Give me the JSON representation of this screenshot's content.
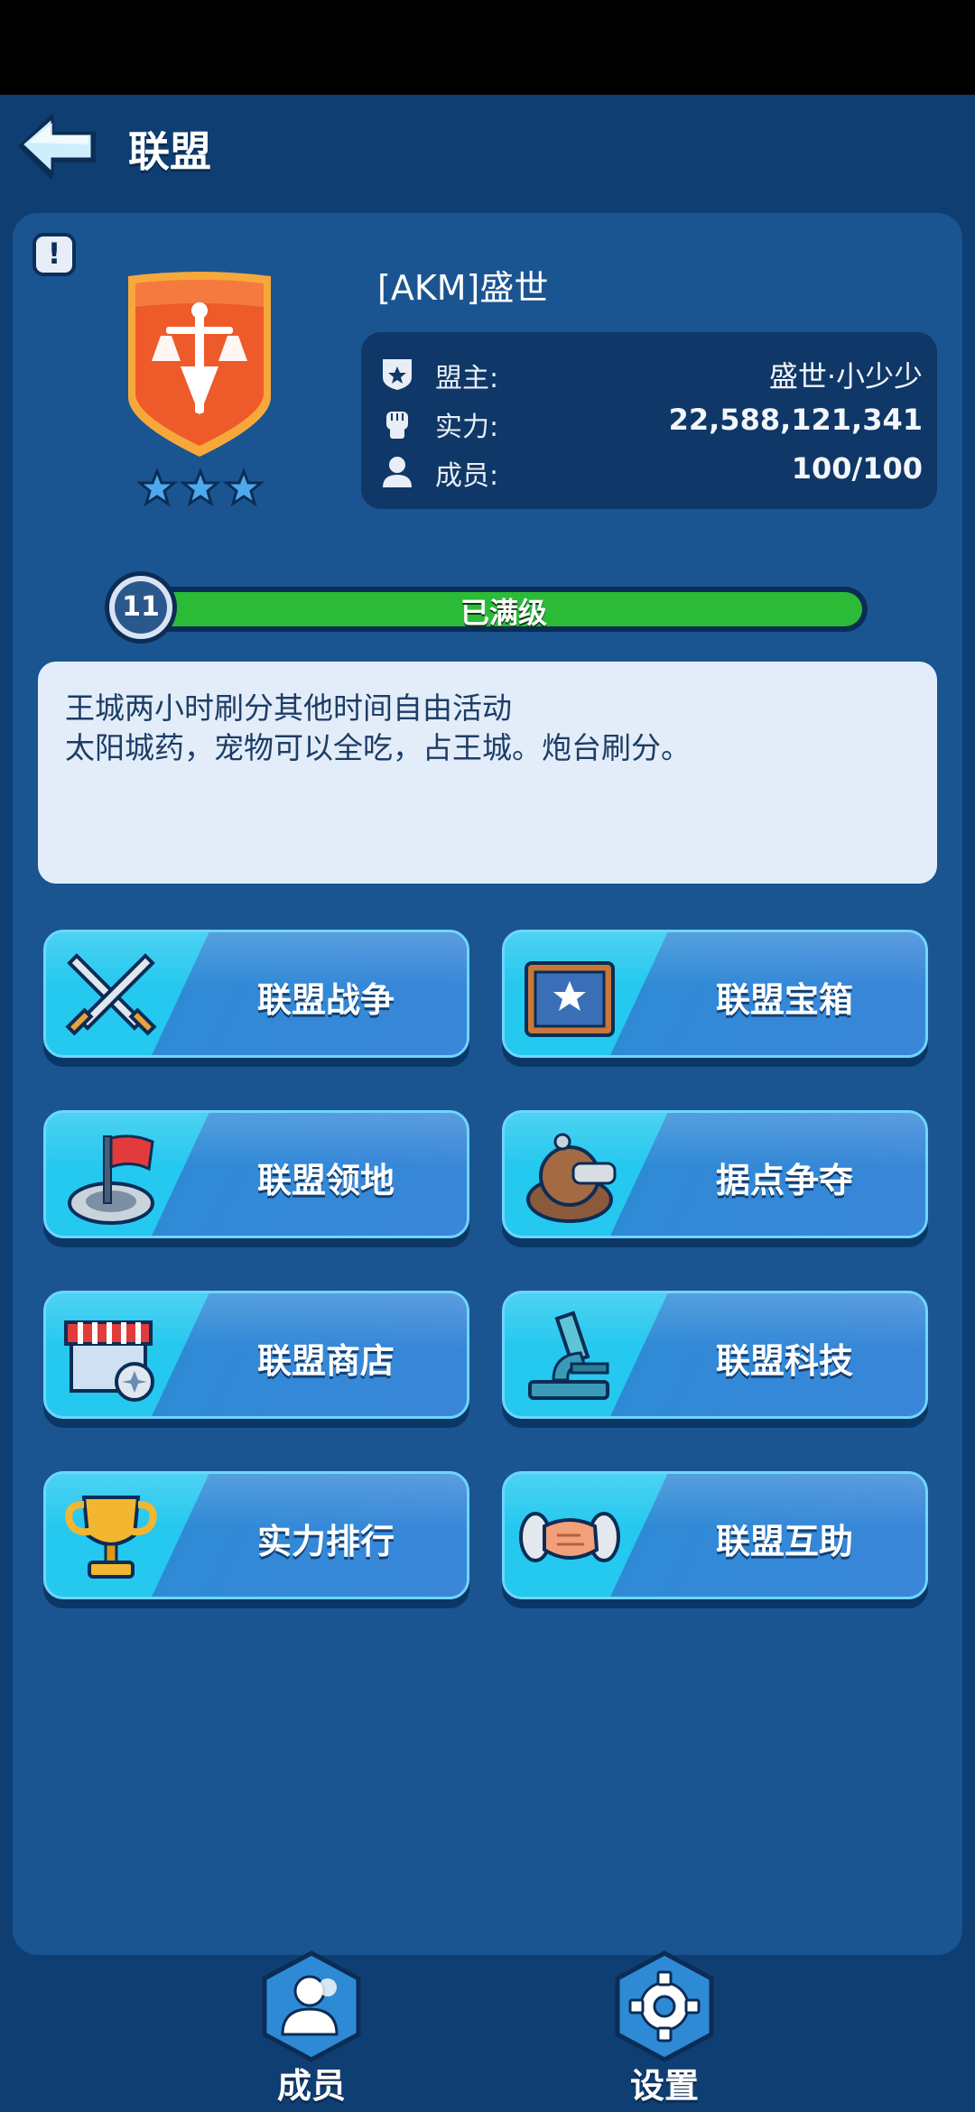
{
  "header": {
    "title": "联盟",
    "back_icon": "back-arrow-icon"
  },
  "guild": {
    "name": "[AKM]盛世",
    "stars": 3,
    "leader_label": "盟主:",
    "leader_value": "盛世·小少少",
    "power_label": "实力:",
    "power_value": "22,588,121,341",
    "members_label": "成员:",
    "members_value": "100/100"
  },
  "level": {
    "number": "11",
    "status": "已满级",
    "progress": 1.0
  },
  "notice": {
    "line1": "王城两小时刷分其他时间自由活动",
    "line2": "太阳城药，宠物可以全吃，占王城。炮台刷分。"
  },
  "features": [
    {
      "label": "联盟战争",
      "icon": "crossed-swords-icon"
    },
    {
      "label": "联盟宝箱",
      "icon": "treasure-chest-icon"
    },
    {
      "label": "联盟领地",
      "icon": "flag-territory-icon"
    },
    {
      "label": "据点争夺",
      "icon": "stronghold-cannon-icon"
    },
    {
      "label": "联盟商店",
      "icon": "shop-stall-icon"
    },
    {
      "label": "联盟科技",
      "icon": "microscope-icon"
    },
    {
      "label": "实力排行",
      "icon": "trophy-icon"
    },
    {
      "label": "联盟互助",
      "icon": "handshake-icon"
    }
  ],
  "bottom_nav": [
    {
      "label": "成员",
      "icon": "members-icon"
    },
    {
      "label": "设置",
      "icon": "gear-icon"
    }
  ],
  "colors": {
    "background": "#0f3e72",
    "panel": "#1b5591",
    "level_fill": "#2bbb37",
    "button_cyan": "#25c8ef",
    "button_blue": "#3a86d9",
    "emblem_orange": "#ee5a2a"
  }
}
